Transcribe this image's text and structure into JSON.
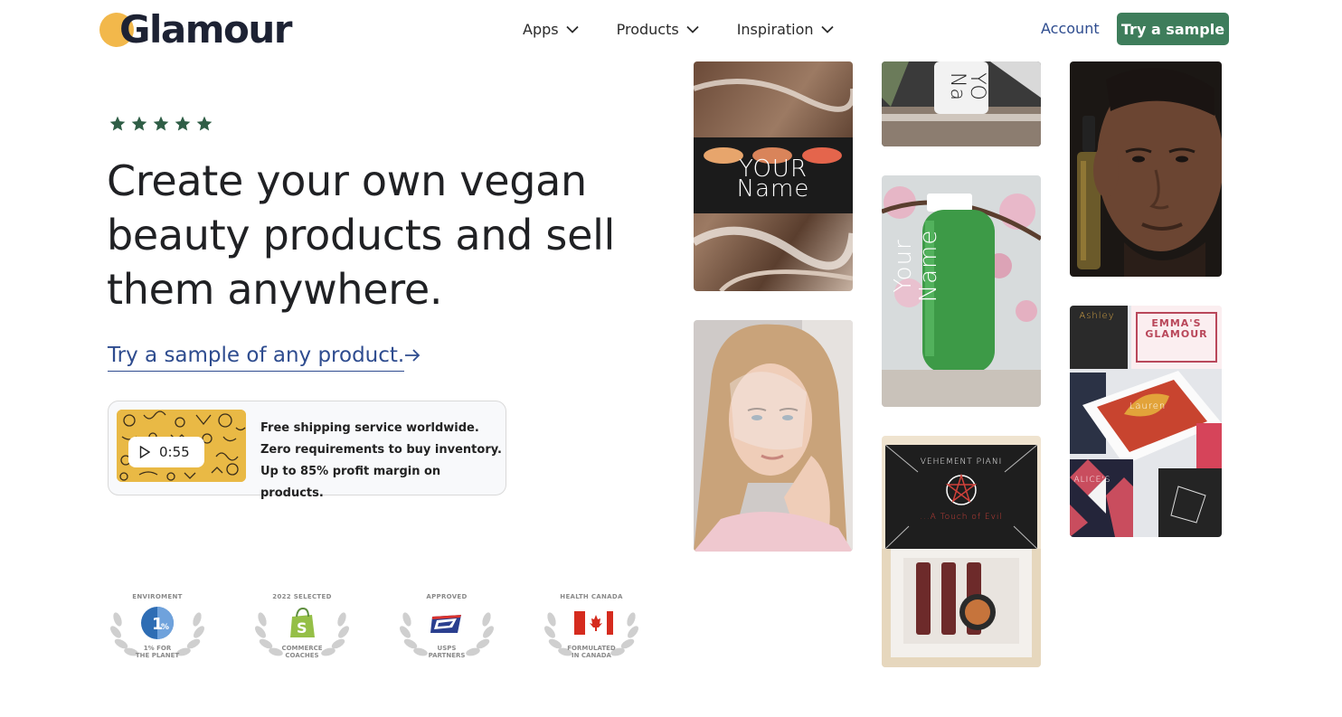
{
  "brand": {
    "name": "Glamour",
    "mark_color": "#f2b84b",
    "text_color": "#1d2233"
  },
  "nav": {
    "items": [
      {
        "label": "Apps"
      },
      {
        "label": "Products"
      },
      {
        "label": "Inspiration"
      }
    ],
    "account_label": "Account",
    "try_label": "Try a sample",
    "accent_color": "#3e7d5b",
    "link_color": "#2e4c8f"
  },
  "hero": {
    "rating_stars": 5,
    "headline_lines": [
      "Create your own vegan",
      "beauty products and sell",
      "them anywhere."
    ],
    "cta_label": "Try a sample of any product.",
    "cta_icon": "arrow-right-icon"
  },
  "info_card": {
    "video_duration": "0:55",
    "lines": [
      "Free shipping service worldwide.",
      "Zero requirements to buy inventory.",
      "Up to 85% profit margin on products."
    ]
  },
  "badges": [
    {
      "top": "ENVIROMENT",
      "bottom": [
        "1% FOR",
        "THE PLANET"
      ],
      "icon": "one-percent-planet-icon"
    },
    {
      "top": "2022 SELECTED",
      "bottom": [
        "COMMERCE",
        "COACHES"
      ],
      "icon": "shopify-bag-icon"
    },
    {
      "top": "APPROVED",
      "bottom": [
        "USPS",
        "PARTNERS"
      ],
      "icon": "usps-eagle-icon"
    },
    {
      "top": "HEALTH CANADA",
      "bottom": [
        "FORMULATED",
        "IN CANADA"
      ],
      "icon": "canada-flag-icon"
    }
  ],
  "gallery": {
    "palette_text": [
      "YOUR",
      "Name"
    ],
    "bottle_text": [
      "Your",
      "Name"
    ],
    "top_bottle_text": [
      "YO",
      "Na"
    ],
    "gift_box_text": "EMMA'S GLAMOUR",
    "card_text": "Lauren",
    "alice_text": "ALICE'S",
    "ashley_text": "Ashley",
    "vampire_box_title": "VEHEMENT PIANI",
    "vampire_box_subtitle": "...A Touch of Evil"
  }
}
